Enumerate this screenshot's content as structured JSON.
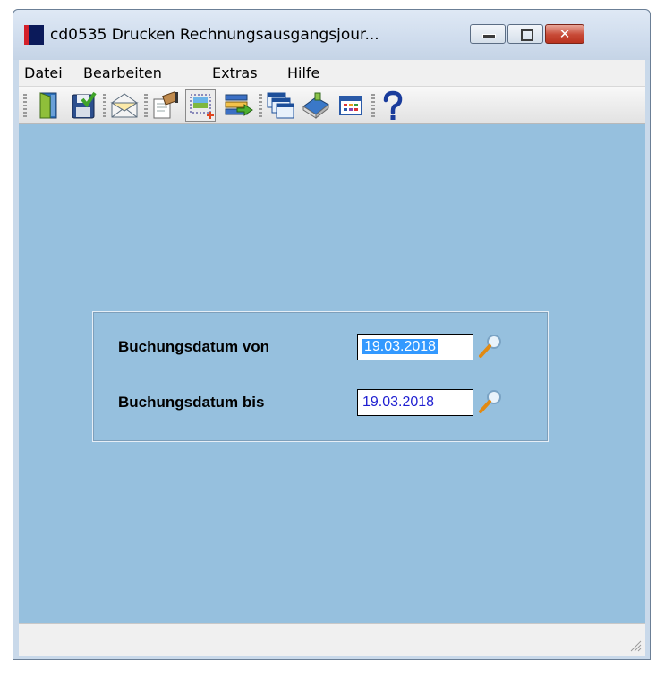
{
  "window": {
    "title": "cd0535 Drucken Rechnungsausgangsjour..."
  },
  "menu": [
    "Datei",
    "Bearbeiten",
    "Extras",
    "Hilfe"
  ],
  "toolbar": {
    "buttons": [
      {
        "icon": "exit-door-icon"
      },
      {
        "icon": "save-icon"
      },
      {
        "icon": "mail-icon"
      },
      {
        "icon": "print-setup-icon"
      },
      {
        "icon": "new-record-icon"
      },
      {
        "icon": "list-import-icon"
      },
      {
        "icon": "windows-icon"
      },
      {
        "icon": "book-icon"
      },
      {
        "icon": "table-icon"
      },
      {
        "icon": "help-icon"
      }
    ]
  },
  "form": {
    "from_label": "Buchungsdatum von",
    "from_value": "19.03.2018",
    "to_label": "Buchungsdatum bis",
    "to_value": "19.03.2018"
  },
  "colors": {
    "client_bg": "#96c0de",
    "selection": "#3399ff",
    "close_button": "#c74936"
  }
}
